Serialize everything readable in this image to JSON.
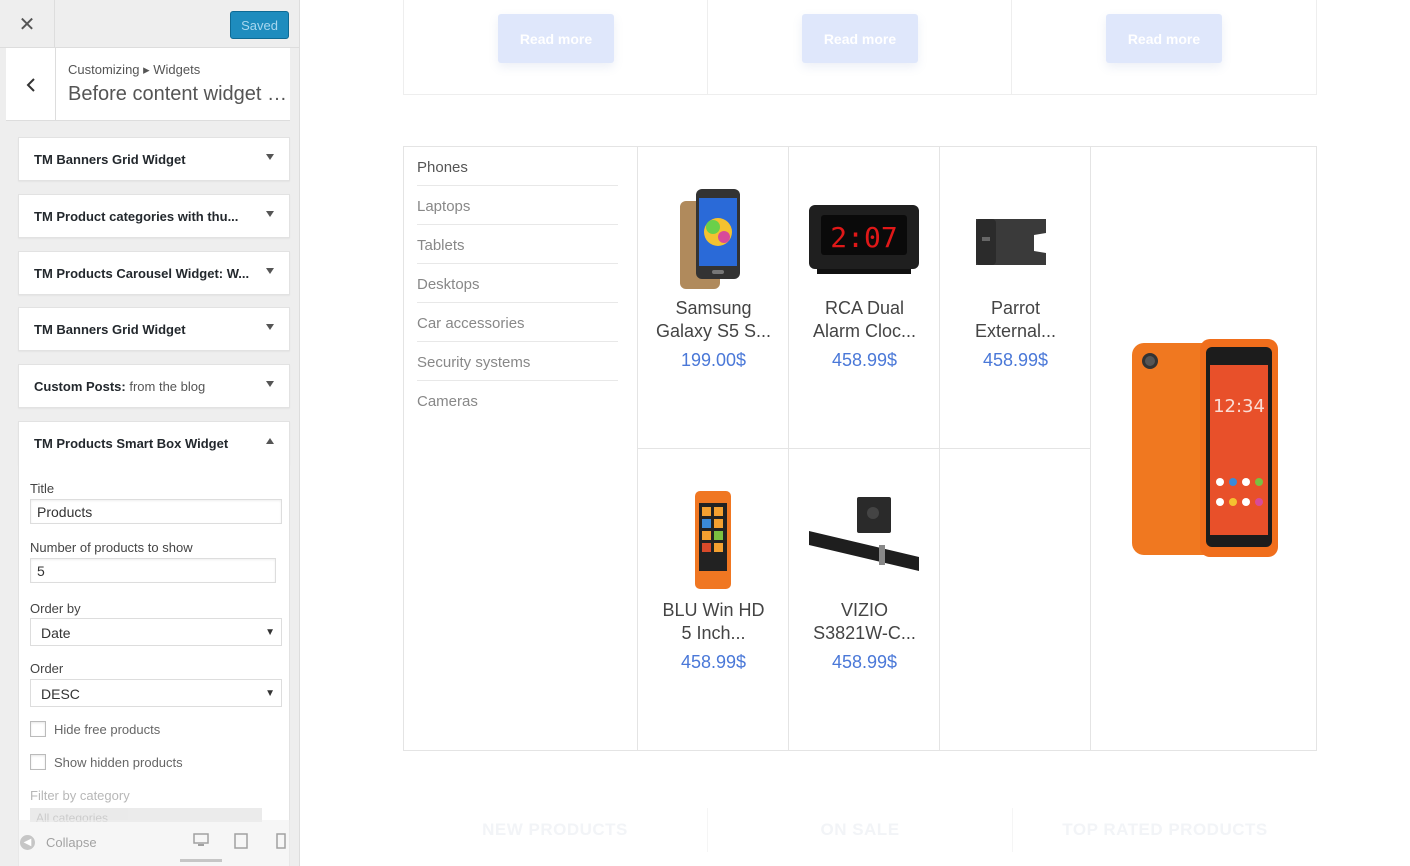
{
  "sidebar": {
    "close_label": "✕",
    "saved_label": "Saved",
    "breadcrumb": "Customizing ▸ Widgets",
    "panel_title": "Before content widget a...",
    "widgets": [
      {
        "title": "TM Banners Grid Widget",
        "sub": ""
      },
      {
        "title": "TM Product categories with thu...",
        "sub": ""
      },
      {
        "title": "TM Products Carousel Widget: W...",
        "sub": ""
      },
      {
        "title": "TM Banners Grid Widget",
        "sub": ""
      },
      {
        "title": "Custom Posts:",
        "sub": " from the blog"
      },
      {
        "title": "TM Products Smart Box Widget",
        "sub": ""
      }
    ],
    "form": {
      "title_label": "Title",
      "title_value": "Products",
      "count_label": "Number of products to show",
      "count_value": "5",
      "order_by_label": "Order by",
      "order_by_value": "Date",
      "order_label": "Order",
      "order_value": "DESC",
      "hide_free_label": "Hide free products",
      "show_hidden_label": "Show hidden products",
      "filter_label": "Filter by category",
      "filter_value": "All categories"
    },
    "footer": {
      "collapse_label": "Collapse"
    }
  },
  "preview": {
    "read_more": [
      "Read more",
      "Read more",
      "Read more"
    ],
    "categories": [
      "Phones",
      "Laptops",
      "Tablets",
      "Desktops",
      "Car accessories",
      "Security systems",
      "Cameras"
    ],
    "products": [
      {
        "line1": "Samsung",
        "line2": "Galaxy S5 S...",
        "price": "199.00$"
      },
      {
        "line1": "RCA Dual",
        "line2": "Alarm Cloc...",
        "price": "458.99$"
      },
      {
        "line1": "Parrot",
        "line2": "External...",
        "price": "458.99$"
      },
      {
        "line1": "BLU Win HD",
        "line2": "5 Inch...",
        "price": "458.99$"
      },
      {
        "line1": "VIZIO",
        "line2": "S3821W-C...",
        "price": "458.99$"
      }
    ],
    "clock_display": "2:07",
    "bottom_tabs": [
      "NEW PRODUCTS",
      "ON SALE",
      "TOP RATED PRODUCTS"
    ]
  }
}
